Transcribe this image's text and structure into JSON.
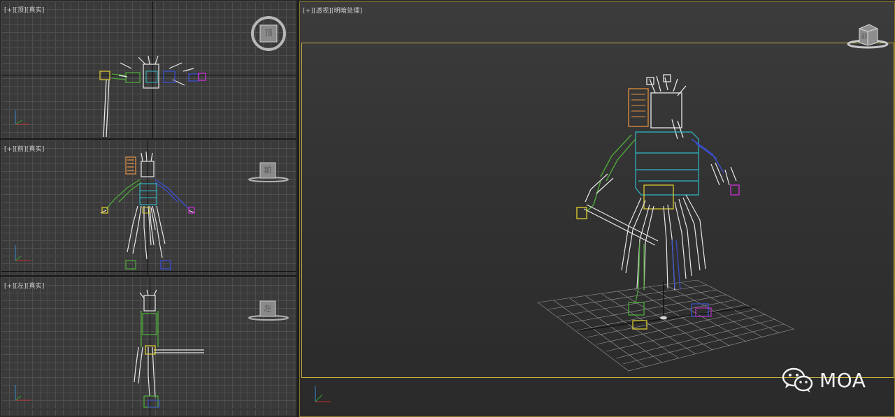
{
  "viewports": {
    "top": {
      "label_plus": "[+]",
      "label_view": "[顶]",
      "label_shade": "[真实]",
      "cube_face": "顶"
    },
    "front": {
      "label_plus": "[+]",
      "label_view": "[前]",
      "label_shade": "[真实]",
      "cube_face": "前"
    },
    "left": {
      "label_plus": "[+]",
      "label_view": "[左]",
      "label_shade": "[真实]",
      "cube_face": "左"
    },
    "perspective": {
      "label_plus": "[+]",
      "label_view": "[透视]",
      "label_shade": "[明暗处理]",
      "cube_face": "前"
    }
  },
  "watermark": {
    "text": "MOA",
    "icon": "wechat-icon"
  },
  "colors": {
    "bone_white": "#e8e8e8",
    "bone_green": "#4ea83a",
    "bone_blue": "#3a4fd0",
    "bone_cyan": "#2fb8c8",
    "bone_yellow": "#d8c830",
    "bone_magenta": "#c030c8",
    "bone_orange": "#e09040",
    "grid_floor": "#9a9a9a"
  }
}
